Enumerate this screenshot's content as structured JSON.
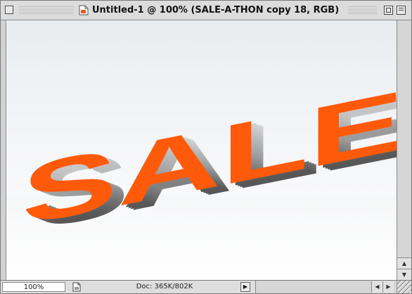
{
  "window": {
    "title": "Untitled-1 @ 100% (SALE-A-THON copy 18, RGB)",
    "icons": {
      "close": "close-box-icon",
      "document": "document-icon",
      "zoom": "zoom-box-icon",
      "collapse": "collapse-box-icon"
    }
  },
  "canvas": {
    "artwork_text": "SALE-A-THON",
    "colors": {
      "letter_face": "#ff5a0a",
      "letter_extrusion_light": "#f2f2f2",
      "letter_extrusion_dark": "#2a2a2a",
      "background_top": "#e9ecef",
      "background_bottom": "#ffffff"
    }
  },
  "statusbar": {
    "zoom": "100%",
    "doc_info": "Doc: 365K/802K",
    "icons": {
      "file": "file-info-icon",
      "menu_arrow": "triangle-right-icon",
      "scroll_left": "arrow-left-icon",
      "scroll_right": "arrow-right-icon",
      "scroll_up": "arrow-up-icon",
      "scroll_down": "arrow-down-icon",
      "grow": "resize-grip-icon"
    }
  }
}
